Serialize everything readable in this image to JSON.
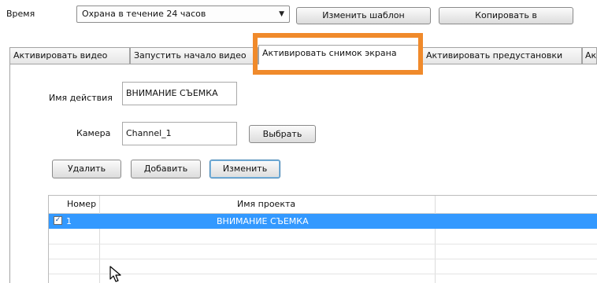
{
  "top": {
    "time_label": "Время",
    "schedule_value": "Охрана в течение 24 часов",
    "edit_template_button": "Изменить шаблон",
    "copy_to_button": "Копировать в"
  },
  "tabs": [
    {
      "label": "Активировать видео"
    },
    {
      "label": "Запустить начало видео"
    },
    {
      "label": "Активировать снимок экрана",
      "active": true
    },
    {
      "label": "Активировать предустановки"
    },
    {
      "label": "Акти"
    }
  ],
  "form": {
    "action_name_label": "Имя действия",
    "action_name_value": "ВНИМАНИЕ СЪЕМКА",
    "camera_label": "Камера",
    "camera_value": "Channel_1",
    "select_button": "Выбрать",
    "delete_button": "Удалить",
    "add_button": "Добавить",
    "change_button": "Изменить"
  },
  "table": {
    "columns": [
      "Номер",
      "Имя проекта"
    ],
    "rows": [
      {
        "checked": true,
        "number": "1",
        "project_name": "ВНИМАНИЕ СЪЕМКА",
        "selected": true
      }
    ]
  },
  "colors": {
    "highlight": "#f08a2b",
    "selection": "#3399ff"
  }
}
